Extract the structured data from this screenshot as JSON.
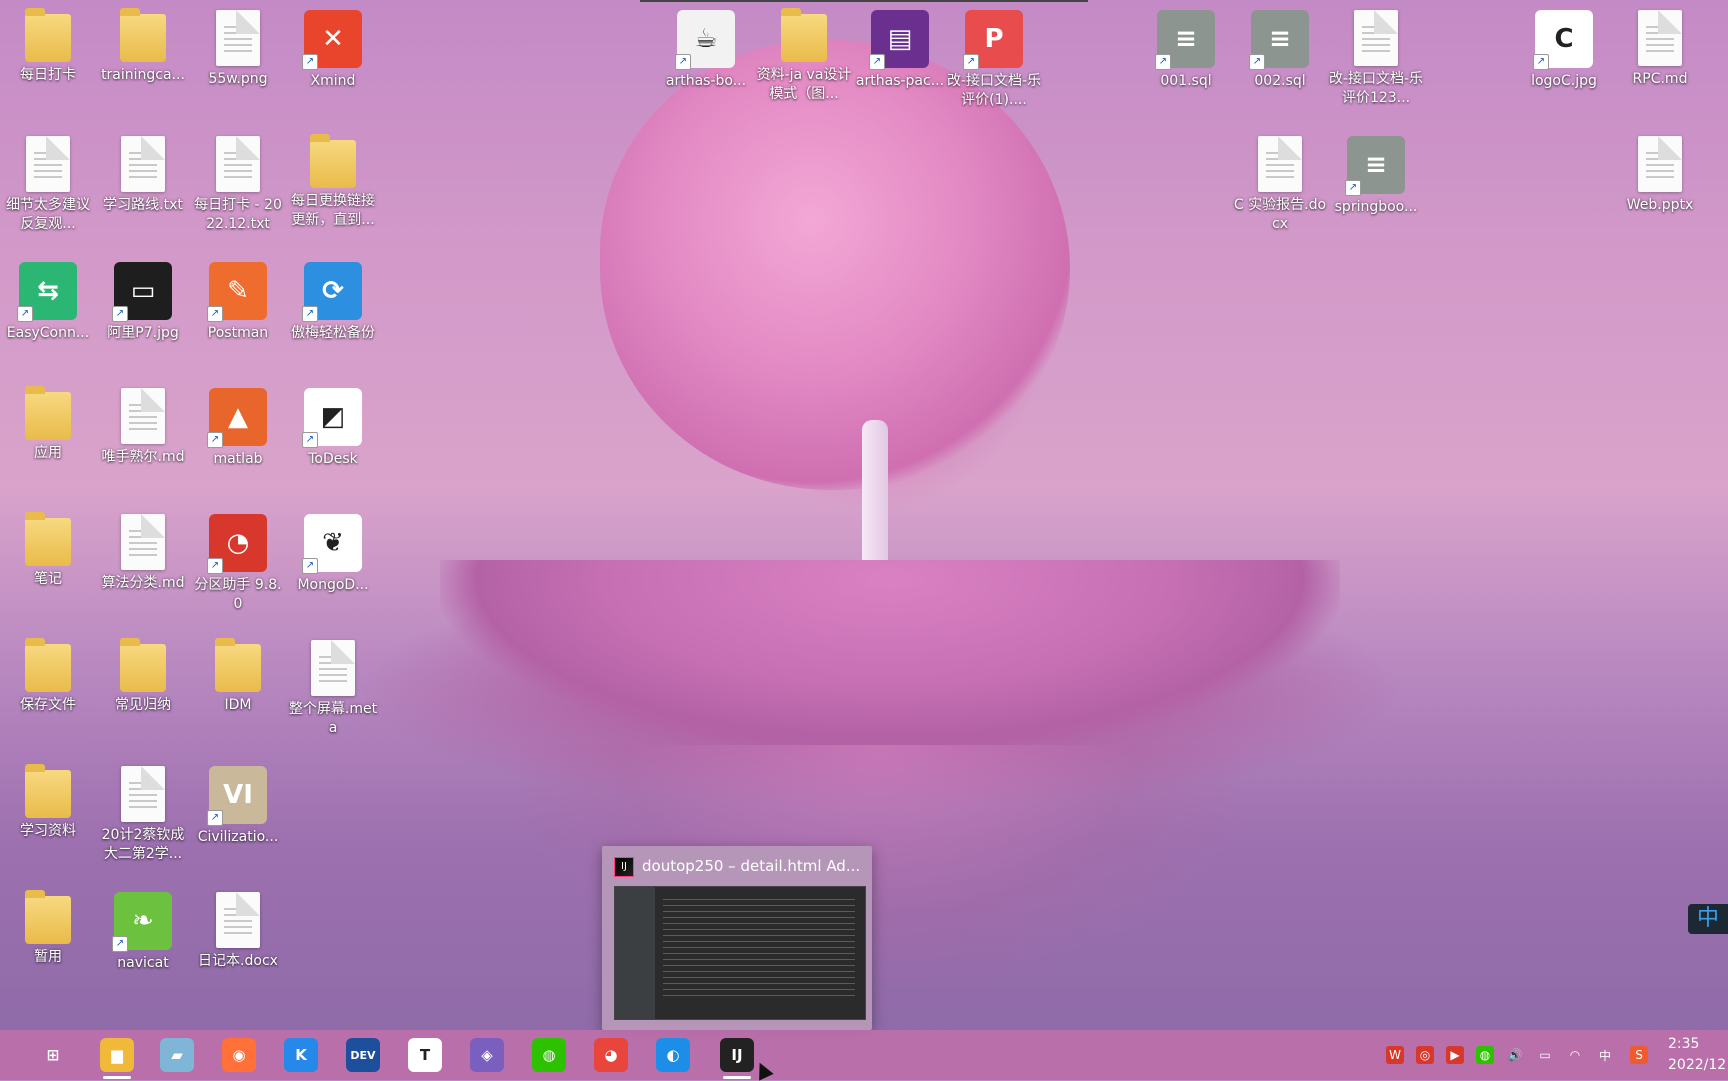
{
  "desktop_icons": [
    {
      "label": "每日打卡",
      "kind": "folder"
    },
    {
      "label": "trainingca...",
      "kind": "folder"
    },
    {
      "label": "55w.png",
      "kind": "doc"
    },
    {
      "label": "Xmind",
      "kind": "app",
      "color": "#e8452c",
      "glyph": "✕"
    },
    {
      "label": "arthas-bo...",
      "kind": "app",
      "color": "#f2f2f2",
      "glyph": "☕"
    },
    {
      "label": "资料-ja va设计模式（图...",
      "kind": "folder"
    },
    {
      "label": "arthas-pac...",
      "kind": "app",
      "color": "#6b2f8f",
      "glyph": "▤"
    },
    {
      "label": "改-接口文档-乐评价(1)....",
      "kind": "app",
      "color": "#e84c4c",
      "glyph": "P"
    },
    {
      "label": "001.sql",
      "kind": "app",
      "color": "#8c9590",
      "glyph": "≡"
    },
    {
      "label": "002.sql",
      "kind": "app",
      "color": "#8c9590",
      "glyph": "≡"
    },
    {
      "label": "改-接口文档-乐评价123...",
      "kind": "doc"
    },
    {
      "label": "logoC.jpg",
      "kind": "app",
      "color": "#ffffff",
      "glyph": "C"
    },
    {
      "label": "RPC.md",
      "kind": "doc"
    },
    {
      "label": "细节太多建议反复观...",
      "kind": "doc"
    },
    {
      "label": "学习路线.txt",
      "kind": "doc"
    },
    {
      "label": "每日打卡 - 2022.12.txt",
      "kind": "doc"
    },
    {
      "label": "每日更换链接更新，直到...",
      "kind": "folder"
    },
    {
      "label": "C 实验报告.docx",
      "kind": "doc"
    },
    {
      "label": "springboo...",
      "kind": "app",
      "color": "#8c9590",
      "glyph": "≡"
    },
    {
      "label": "Web.pptx",
      "kind": "doc"
    },
    {
      "label": "EasyConn...",
      "kind": "app",
      "color": "#2bb673",
      "glyph": "⇆"
    },
    {
      "label": "阿里P7.jpg",
      "kind": "app",
      "color": "#1e1e1e",
      "glyph": "▭"
    },
    {
      "label": "Postman",
      "kind": "app",
      "color": "#ef6c2f",
      "glyph": "✎"
    },
    {
      "label": "傲梅轻松备份",
      "kind": "app",
      "color": "#2c8fe0",
      "glyph": "⟳"
    },
    {
      "label": "应用",
      "kind": "folder"
    },
    {
      "label": "唯手熟尔.md",
      "kind": "doc"
    },
    {
      "label": "matlab",
      "kind": "app",
      "color": "#e8652c",
      "glyph": "▲"
    },
    {
      "label": "ToDesk",
      "kind": "app",
      "color": "#ffffff",
      "glyph": "◩"
    },
    {
      "label": "笔记",
      "kind": "folder"
    },
    {
      "label": "算法分类.md",
      "kind": "doc"
    },
    {
      "label": "分区助手 9.8.0",
      "kind": "app",
      "color": "#d8372c",
      "glyph": "◔"
    },
    {
      "label": "MongoD...",
      "kind": "app",
      "color": "#ffffff",
      "glyph": "❦"
    },
    {
      "label": "保存文件",
      "kind": "folder"
    },
    {
      "label": "常见归纳",
      "kind": "folder"
    },
    {
      "label": "IDM",
      "kind": "folder"
    },
    {
      "label": "整个屏幕.meta",
      "kind": "doc"
    },
    {
      "label": "学习资料",
      "kind": "folder"
    },
    {
      "label": "20计2蔡钦成大二第2学...",
      "kind": "doc"
    },
    {
      "label": "Civilizatio...",
      "kind": "app",
      "color": "#c9b99a",
      "glyph": "VI"
    },
    {
      "label": "暂用",
      "kind": "folder"
    },
    {
      "label": "navicat",
      "kind": "app",
      "color": "#6cc13f",
      "glyph": "❧"
    },
    {
      "label": "日记本.docx",
      "kind": "doc"
    }
  ],
  "preview": {
    "title": "doutop250 – detail.html Ad...",
    "app_icon": "intellij-idea-icon"
  },
  "taskbar": {
    "items": [
      {
        "name": "task-view-icon",
        "glyph": "⊞",
        "color": "transparent"
      },
      {
        "name": "file-explorer-icon",
        "glyph": "▆",
        "color": "#f0b93a"
      },
      {
        "name": "notes-icon",
        "glyph": "▰",
        "color": "#7fb6d8"
      },
      {
        "name": "firefox-icon",
        "glyph": "◉",
        "color": "#ff7139"
      },
      {
        "name": "kugou-icon",
        "glyph": "K",
        "color": "#2688e8"
      },
      {
        "name": "devcpp-icon",
        "glyph": "DEV",
        "color": "#1e4f9c"
      },
      {
        "name": "typora-icon",
        "glyph": "T",
        "color": "#ffffff"
      },
      {
        "name": "visual-studio-icon",
        "glyph": "◈",
        "color": "#7b5fbf"
      },
      {
        "name": "wechat-icon",
        "glyph": "◍",
        "color": "#2dc100"
      },
      {
        "name": "chrome-icon",
        "glyph": "◕",
        "color": "#e8453c"
      },
      {
        "name": "edge-icon",
        "glyph": "◐",
        "color": "#1c8ee8"
      },
      {
        "name": "intellij-idea-icon",
        "glyph": "IJ",
        "color": "#222"
      }
    ],
    "tray": [
      {
        "name": "wps-tray-icon",
        "glyph": "W",
        "color": "#d8372c"
      },
      {
        "name": "netease-music-tray-icon",
        "glyph": "◎",
        "color": "#d8372c"
      },
      {
        "name": "video-tray-icon",
        "glyph": "▶",
        "color": "#d8372c"
      },
      {
        "name": "wechat-tray-icon",
        "glyph": "◍",
        "color": "#2dc100"
      },
      {
        "name": "volume-icon",
        "glyph": "🔊",
        "color": "transparent"
      },
      {
        "name": "battery-icon",
        "glyph": "▭",
        "color": "transparent"
      },
      {
        "name": "wifi-icon",
        "glyph": "◠",
        "color": "transparent"
      },
      {
        "name": "ime-tray-label",
        "glyph": "中",
        "color": "transparent"
      },
      {
        "name": "sogou-tray-icon",
        "glyph": "S",
        "color": "#ef5a2f"
      }
    ],
    "clock_time": "2:35",
    "clock_date": "2022/12"
  },
  "ime_badge": "中",
  "colors": {
    "taskbar": "#bc70aa",
    "accent": "#ff3d7f"
  }
}
